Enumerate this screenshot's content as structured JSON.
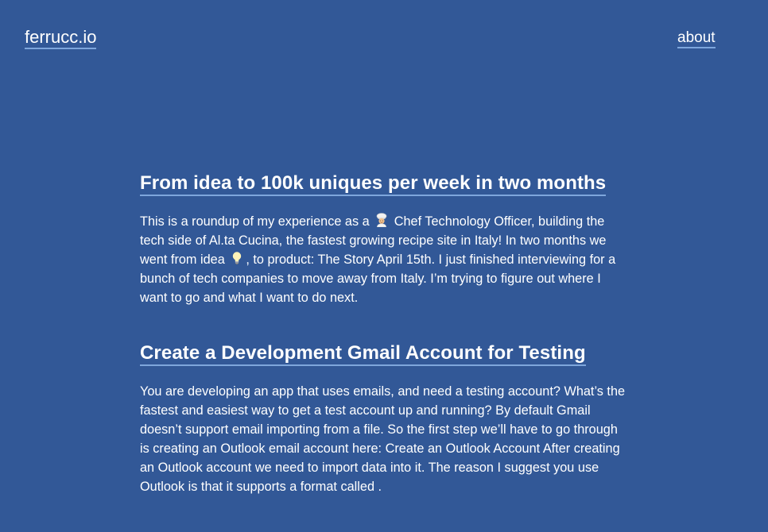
{
  "header": {
    "logo": "ferrucc.io",
    "nav_about": "about"
  },
  "posts": [
    {
      "title": "From idea to 100k uniques per week in two months",
      "excerpt_part1": "This is a roundup of my experience as a ",
      "emoji1": "chef-emoji-icon",
      "excerpt_part2": " Chef Technology Officer, building the tech side of Al.ta Cucina, the fastest growing recipe site in Italy! In two months we went from idea ",
      "emoji2": "lightbulb-emoji-icon",
      "excerpt_part3": ", to product: The Story April 15th. I just finished interviewing for a bunch of tech companies to move away from Italy. I’m trying to figure out where I want to go and what I want to do next."
    },
    {
      "title": "Create a Development Gmail Account for Testing",
      "excerpt": "You are developing an app that uses emails, and need a testing account? What’s the fastest and easiest way to get a test account up and running? By default Gmail doesn’t support email importing from a file. So the first step we’ll have to go through is creating an Outlook email account here: Create an Outlook Account After creating an Outlook account we need to import data into it. The reason I suggest you use Outlook is that it supports a format called ."
    }
  ],
  "colors": {
    "background": "#325897",
    "text": "#ffffff",
    "link_underline": "#7ea6dc"
  }
}
